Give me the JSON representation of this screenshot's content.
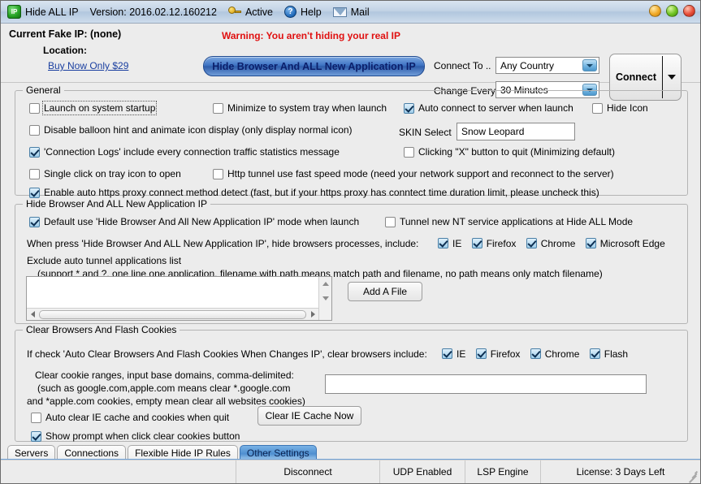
{
  "titlebar": {
    "app_name": "Hide ALL IP",
    "logo_text": "IP",
    "version": "Version: 2016.02.12.160212",
    "active_label": "Active",
    "help_label": "Help",
    "mail_label": "Mail",
    "help_glyph": "?"
  },
  "header": {
    "current_fake_ip": "Current Fake IP: (none)",
    "location": "Location:",
    "buy_now": "Buy Now Only $29",
    "warning": "Warning: You aren't hiding your real IP",
    "hide_browser_button": "Hide Browser And ALL New Application IP",
    "connect_to_label": "Connect To ..",
    "connect_to_value": "Any Country",
    "change_every_label": "Change Every",
    "change_every_value": "30 Minutes",
    "connect_button": "Connect"
  },
  "general": {
    "title": "General",
    "launch_on_startup": "Launch on system startup",
    "minimize_to_tray": "Minimize to system tray when launch",
    "auto_connect": "Auto connect to server when launch",
    "hide_icon": "Hide Icon",
    "disable_balloon": "Disable balloon hint and animate icon display (only display normal icon)",
    "skin_select_label": "SKIN Select",
    "skin_select_value": "Snow Leopard",
    "connection_logs": "'Connection Logs' include every connection traffic statistics message",
    "clicking_x_to_quit": "Clicking \"X\" button to quit (Minimizing default)",
    "single_click_tray": "Single click on tray icon to open",
    "http_tunnel_fast": "Http tunnel use fast speed mode (need your network support and reconnect to the server)",
    "auto_https_detect": "Enable auto https proxy connect method detect (fast,  but if your https proxy has conntect time duration limit, please uncheck this)"
  },
  "hide_browser": {
    "title": "Hide Browser And ALL New Application IP",
    "default_use_mode": "Default use 'Hide Browser And All New Application IP' mode when launch",
    "tunnel_nt_service": "Tunnel new NT service applications at Hide ALL Mode",
    "when_press_text": "When press 'Hide Browser And ALL New Application IP', hide browsers processes, include:",
    "browsers": [
      {
        "label": "IE",
        "checked": true
      },
      {
        "label": "Firefox",
        "checked": true
      },
      {
        "label": "Chrome",
        "checked": true
      },
      {
        "label": "Microsoft Edge",
        "checked": true
      }
    ],
    "exclude_title": "Exclude auto tunnel applications list",
    "exclude_hint": "(support * and ?, one line one application, filename with path means match path and filename,  no path means only match filename)",
    "exclude_list_value": "",
    "add_file_button": "Add A File"
  },
  "clear_cookies": {
    "title": "Clear Browsers And Flash Cookies",
    "if_check_text": "If check 'Auto Clear Browsers And Flash Cookies When Changes IP', clear browsers include:",
    "browsers": [
      {
        "label": "IE",
        "checked": true
      },
      {
        "label": "Firefox",
        "checked": true
      },
      {
        "label": "Chrome",
        "checked": true
      },
      {
        "label": "Flash",
        "checked": true
      }
    ],
    "ranges_line1": "Clear cookie ranges, input base domains,  comma-delimited:",
    "ranges_line2": "(such as google.com,apple.com means clear *.google.com",
    "ranges_line3": "and *apple.com cookies, empty mean clear all websites cookies)",
    "cookie_input_value": "",
    "auto_clear_ie": "Auto clear IE cache and cookies when quit",
    "clear_ie_cache_button": "Clear IE Cache Now",
    "show_prompt": "Show prompt when click clear cookies button"
  },
  "tabs": [
    {
      "label": "Servers",
      "active": false
    },
    {
      "label": "Connections",
      "active": false
    },
    {
      "label": "Flexible Hide IP Rules",
      "active": false
    },
    {
      "label": "Other Settings",
      "active": true
    }
  ],
  "statusbar": {
    "empty": "",
    "disconnect": "Disconnect",
    "udp": "UDP Enabled",
    "lsp": "LSP Engine",
    "license": "License: 3 Days Left"
  },
  "colors": {
    "warning_red": "#e01010",
    "link_blue": "#1a3fa0",
    "accent_blue": "#4f8fd0",
    "window_bg": "#ececec"
  }
}
